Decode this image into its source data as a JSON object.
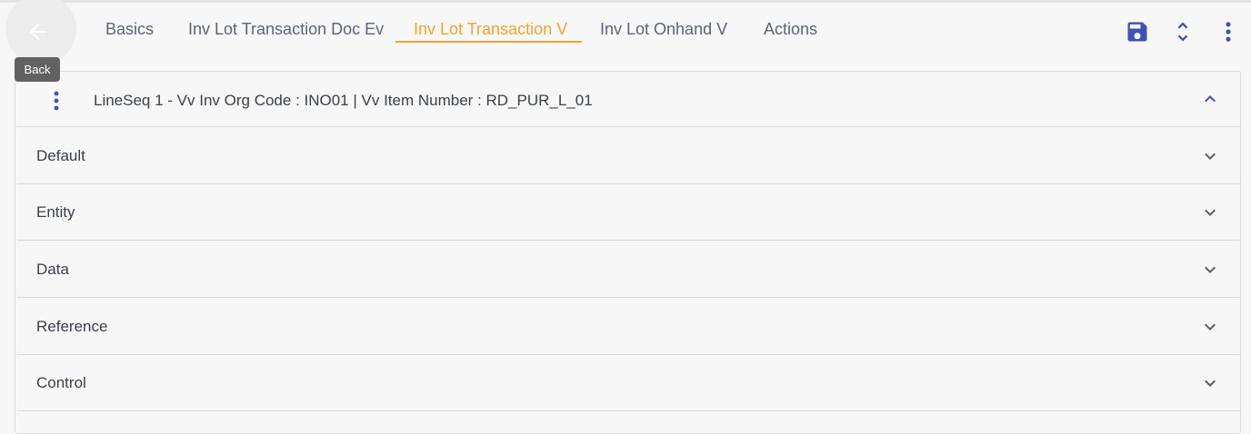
{
  "back": {
    "tooltip": "Back",
    "icon": "arrow-left-icon"
  },
  "tabs": [
    {
      "label": "Basics",
      "active": false
    },
    {
      "label": "Inv Lot Transaction Doc Ev",
      "active": false
    },
    {
      "label": "Inv Lot Transaction V",
      "active": true
    },
    {
      "label": "Inv Lot Onhand V",
      "active": false
    },
    {
      "label": "Actions",
      "active": false
    }
  ],
  "toolbar": {
    "save_icon": "save-icon",
    "expand_collapse_icon": "unfold-icon",
    "more_icon": "more-vertical-icon"
  },
  "record": {
    "title": "LineSeq 1 - Vv Inv Org Code  : INO01 | Vv Item Number  : RD_PUR_L_01",
    "expanded": true
  },
  "sections": [
    {
      "label": "Default"
    },
    {
      "label": "Entity"
    },
    {
      "label": "Data"
    },
    {
      "label": "Reference"
    },
    {
      "label": "Control"
    }
  ],
  "colors": {
    "accent": "#f5a12a",
    "primary": "#3f51b5",
    "text": "#3a3f4a",
    "tab_text": "#5d6474"
  }
}
